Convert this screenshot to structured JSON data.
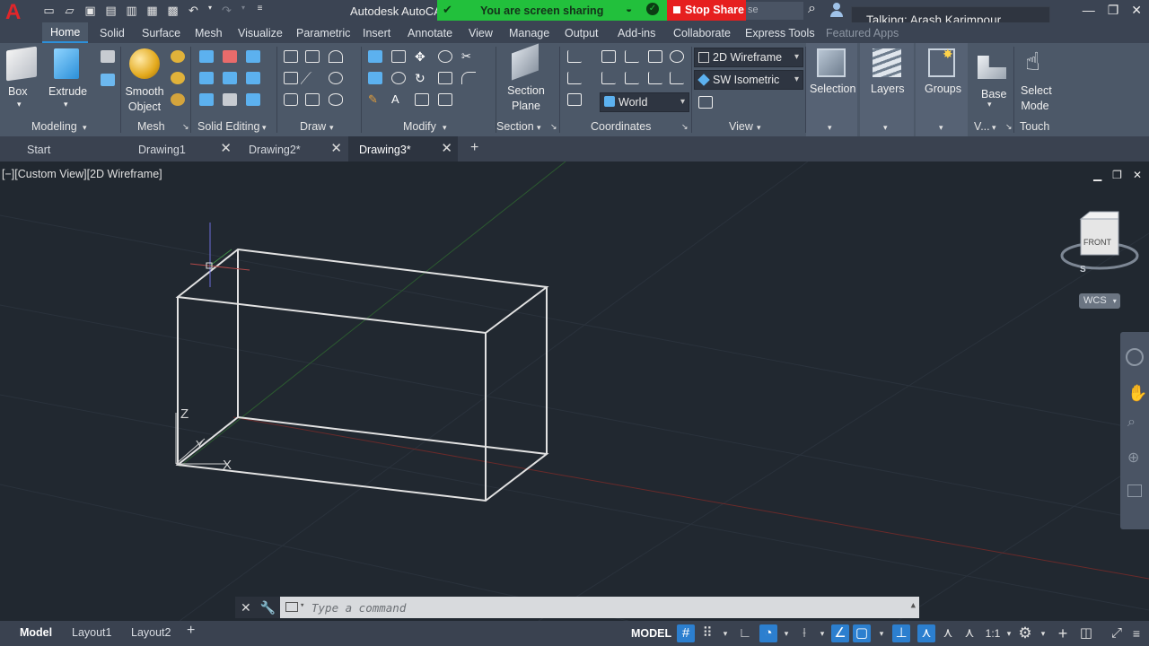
{
  "app": {
    "logo": "A",
    "title": "Autodesk AutoCA",
    "search_partial": "se",
    "talking": "Talking: Arash Karimpour"
  },
  "share": {
    "message": "You are screen sharing",
    "stop_label": "Stop Share"
  },
  "ribbon_tabs": [
    "Home",
    "Solid",
    "Surface",
    "Mesh",
    "Visualize",
    "Parametric",
    "Insert",
    "Annotate",
    "View",
    "Manage",
    "Output",
    "Add-ins",
    "Collaborate",
    "Express Tools",
    "Featured Apps"
  ],
  "ribbon": {
    "box": "Box",
    "extrude": "Extrude",
    "smooth_object": "Smooth Object",
    "section_plane": "Section Plane",
    "selection": "Selection",
    "layers": "Layers",
    "groups": "Groups",
    "base": "Base",
    "select_mode": "Select Mode",
    "visual_style": "2D Wireframe",
    "view_preset": "SW Isometric",
    "ucs": "World",
    "panels": {
      "modeling": "Modeling",
      "mesh": "Mesh",
      "solid_editing": "Solid Editing",
      "draw": "Draw",
      "modify": "Modify",
      "section": "Section",
      "coordinates": "Coordinates",
      "view": "View",
      "view_short": "V...",
      "touch": "Touch"
    }
  },
  "file_tabs": [
    {
      "label": "Start",
      "closable": false
    },
    {
      "label": "Drawing1",
      "closable": true
    },
    {
      "label": "Drawing2*",
      "closable": true
    },
    {
      "label": "Drawing3*",
      "closable": true,
      "active": true
    }
  ],
  "viewport": {
    "label": "[−][Custom View][2D Wireframe]",
    "viewcube_face": "FRONT",
    "viewcube_compass": "S",
    "wcs": "WCS",
    "ucs_axis_z": "Z",
    "ucs_axis_y": "Y",
    "ucs_axis_x": "X"
  },
  "command": {
    "placeholder": "Type a command"
  },
  "status": {
    "layout_tabs": [
      "Model",
      "Layout1",
      "Layout2"
    ],
    "space": "MODEL",
    "scale": "1:1"
  },
  "colors": {
    "accent_blue": "#2d90d9",
    "share_green": "#22c03c",
    "stop_red": "#e61f1f",
    "canvas": "#212830"
  }
}
